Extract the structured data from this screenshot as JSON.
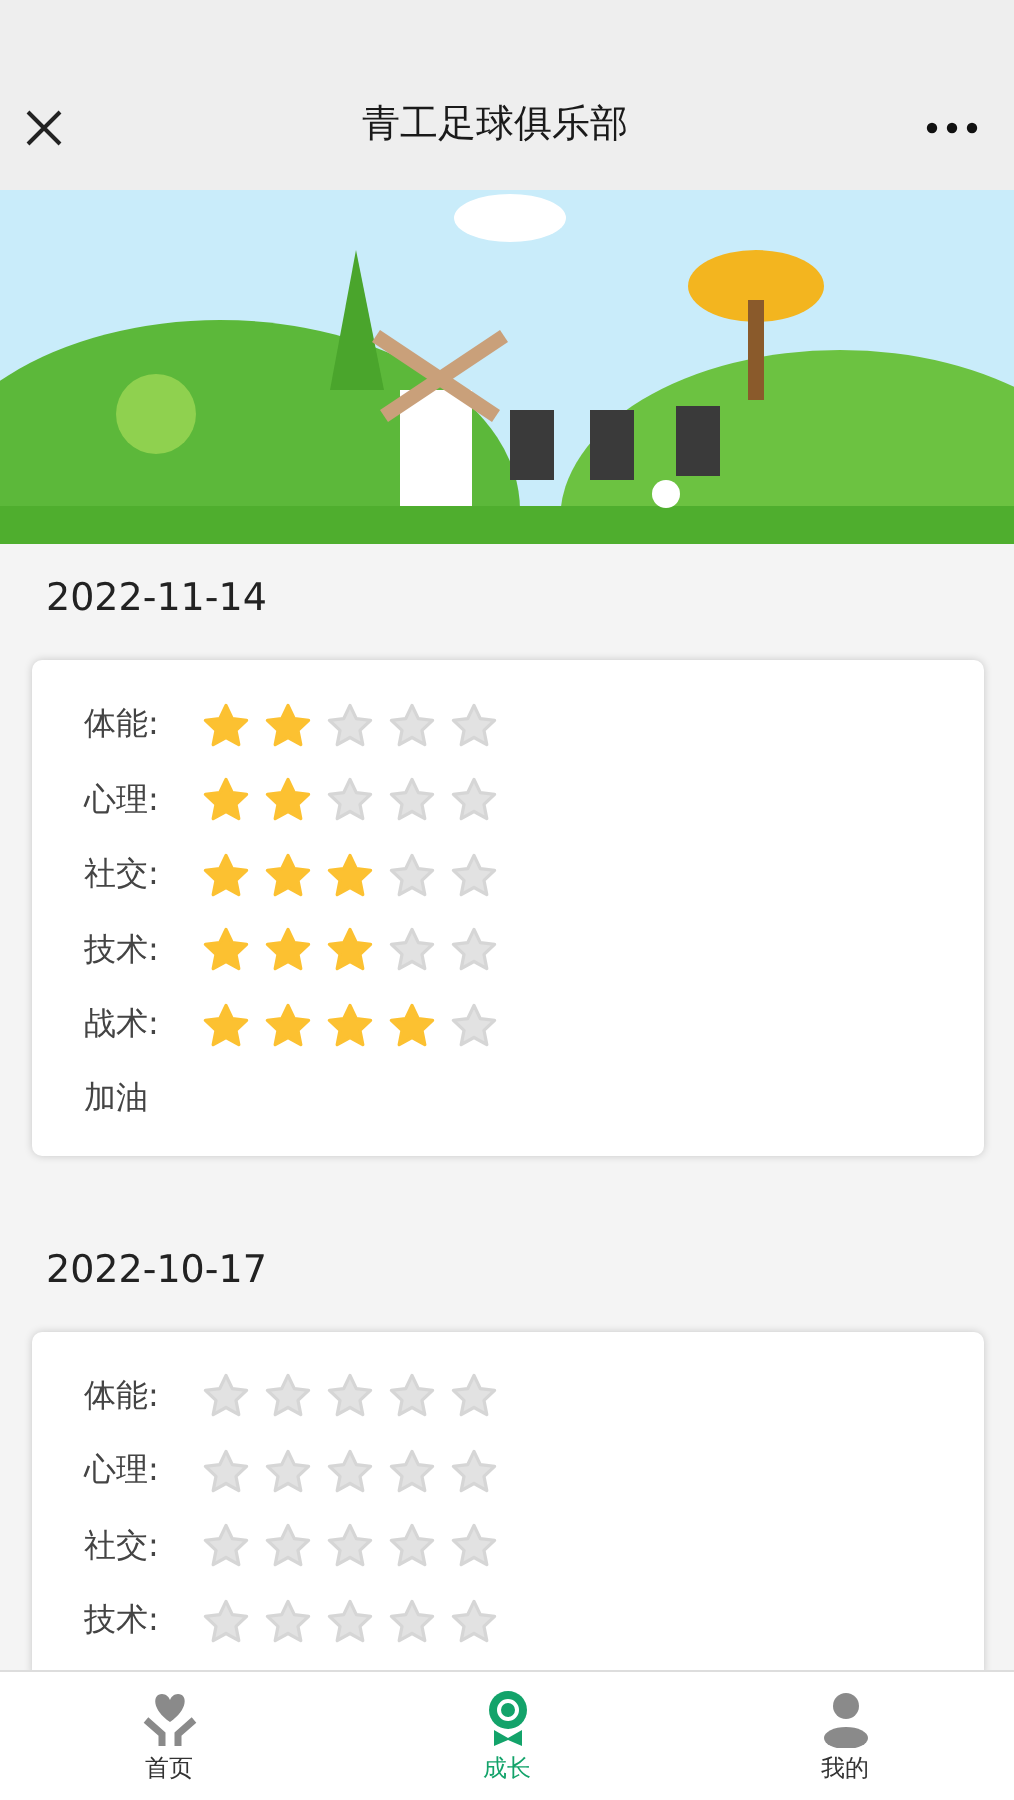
{
  "nav_bar": {
    "title": "青工足球俱乐部"
  },
  "entries": [
    {
      "date": "2022-11-14",
      "ratings": [
        {
          "label": "体能:",
          "stars": 2
        },
        {
          "label": "心理:",
          "stars": 2
        },
        {
          "label": "社交:",
          "stars": 3
        },
        {
          "label": "技术:",
          "stars": 3
        },
        {
          "label": "战术:",
          "stars": 4
        }
      ],
      "comment": "加油"
    },
    {
      "date": "2022-10-17",
      "ratings": [
        {
          "label": "体能:",
          "stars": 0
        },
        {
          "label": "心理:",
          "stars": 0
        },
        {
          "label": "社交:",
          "stars": 0
        },
        {
          "label": "技术:",
          "stars": 0
        }
      ]
    }
  ],
  "tab_bar": [
    {
      "label": "首页",
      "kind": "home",
      "selected": false
    },
    {
      "label": "成长",
      "kind": "growth",
      "selected": true
    },
    {
      "label": "我的",
      "kind": "profile",
      "selected": false
    }
  ]
}
